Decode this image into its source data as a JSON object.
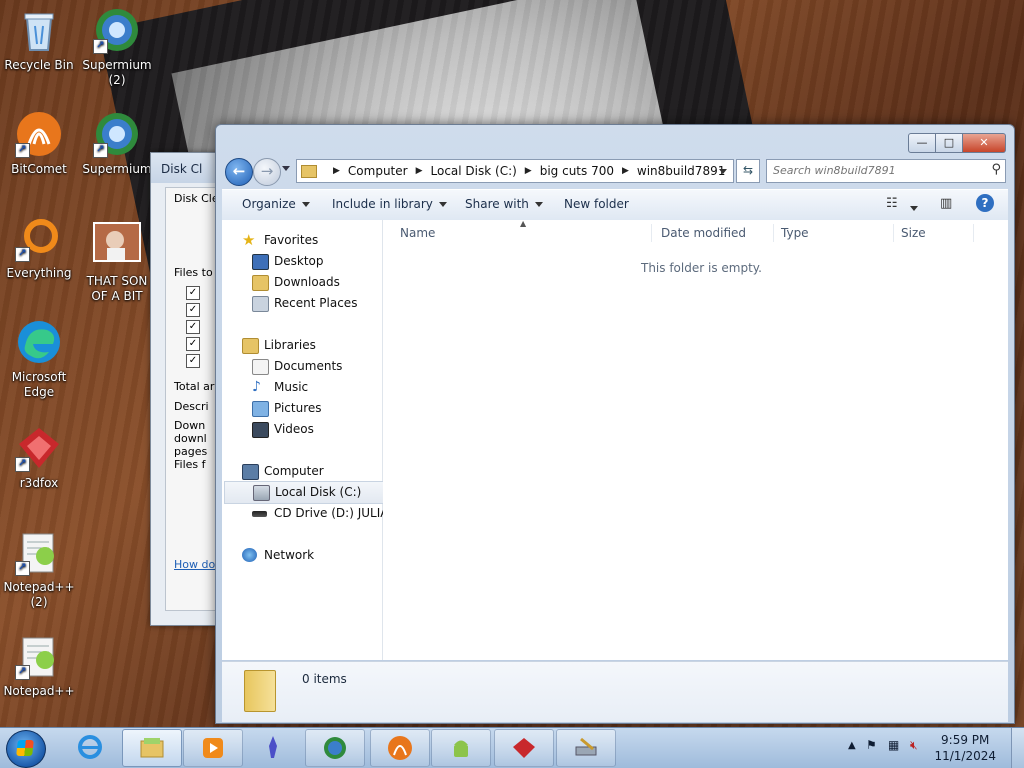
{
  "desktop": {
    "icons": [
      {
        "label": "Recycle Bin",
        "kind": "recycle"
      },
      {
        "label": "Supermium\n(2)",
        "kind": "supermium"
      },
      {
        "label": "BitComet",
        "kind": "bitcomet"
      },
      {
        "label": "Supermium",
        "kind": "supermium"
      },
      {
        "label": "Everything",
        "kind": "everything"
      },
      {
        "label": "THAT SON\nOF A BIT",
        "kind": "photo"
      },
      {
        "label": "Microsoft\nEdge",
        "kind": "edge"
      },
      {
        "label": "r3dfox",
        "kind": "r3dfox"
      },
      {
        "label": "Notepad++\n(2)",
        "kind": "notepadpp"
      },
      {
        "label": "Notepad++",
        "kind": "notepadpp"
      }
    ]
  },
  "disk_cleanup": {
    "title": "Disk Cl",
    "tab": "Disk Clea",
    "files_to": "Files to",
    "total": "Total ar",
    "desc_heading": "Descri",
    "desc_lines": [
      "Down",
      "downl",
      "pages",
      "Files f"
    ],
    "howdo": "How do"
  },
  "explorer": {
    "buttons": {
      "minimize": "—",
      "maximize": "□",
      "close": "✕"
    },
    "breadcrumbs": [
      "Computer",
      "Local Disk (C:)",
      "big cuts 700",
      "win8build7891"
    ],
    "search_placeholder": "Search win8build7891",
    "toolbar": {
      "organize": "Organize",
      "include_in_library": "Include in library",
      "share_with": "Share with",
      "new_folder": "New folder"
    },
    "nav": {
      "favorites": "Favorites",
      "desktop": "Desktop",
      "downloads": "Downloads",
      "recent_places": "Recent Places",
      "libraries": "Libraries",
      "documents": "Documents",
      "music": "Music",
      "pictures": "Pictures",
      "videos": "Videos",
      "computer": "Computer",
      "local_disk": "Local Disk (C:)",
      "cd_drive": "CD Drive (D:) JULIA",
      "network": "Network"
    },
    "columns": {
      "name": "Name",
      "date_modified": "Date modified",
      "type": "Type",
      "size": "Size"
    },
    "empty_message": "This folder is empty.",
    "item_count": "0 items"
  },
  "taskbar": {
    "time": "9:59 PM",
    "date": "11/1/2024"
  }
}
